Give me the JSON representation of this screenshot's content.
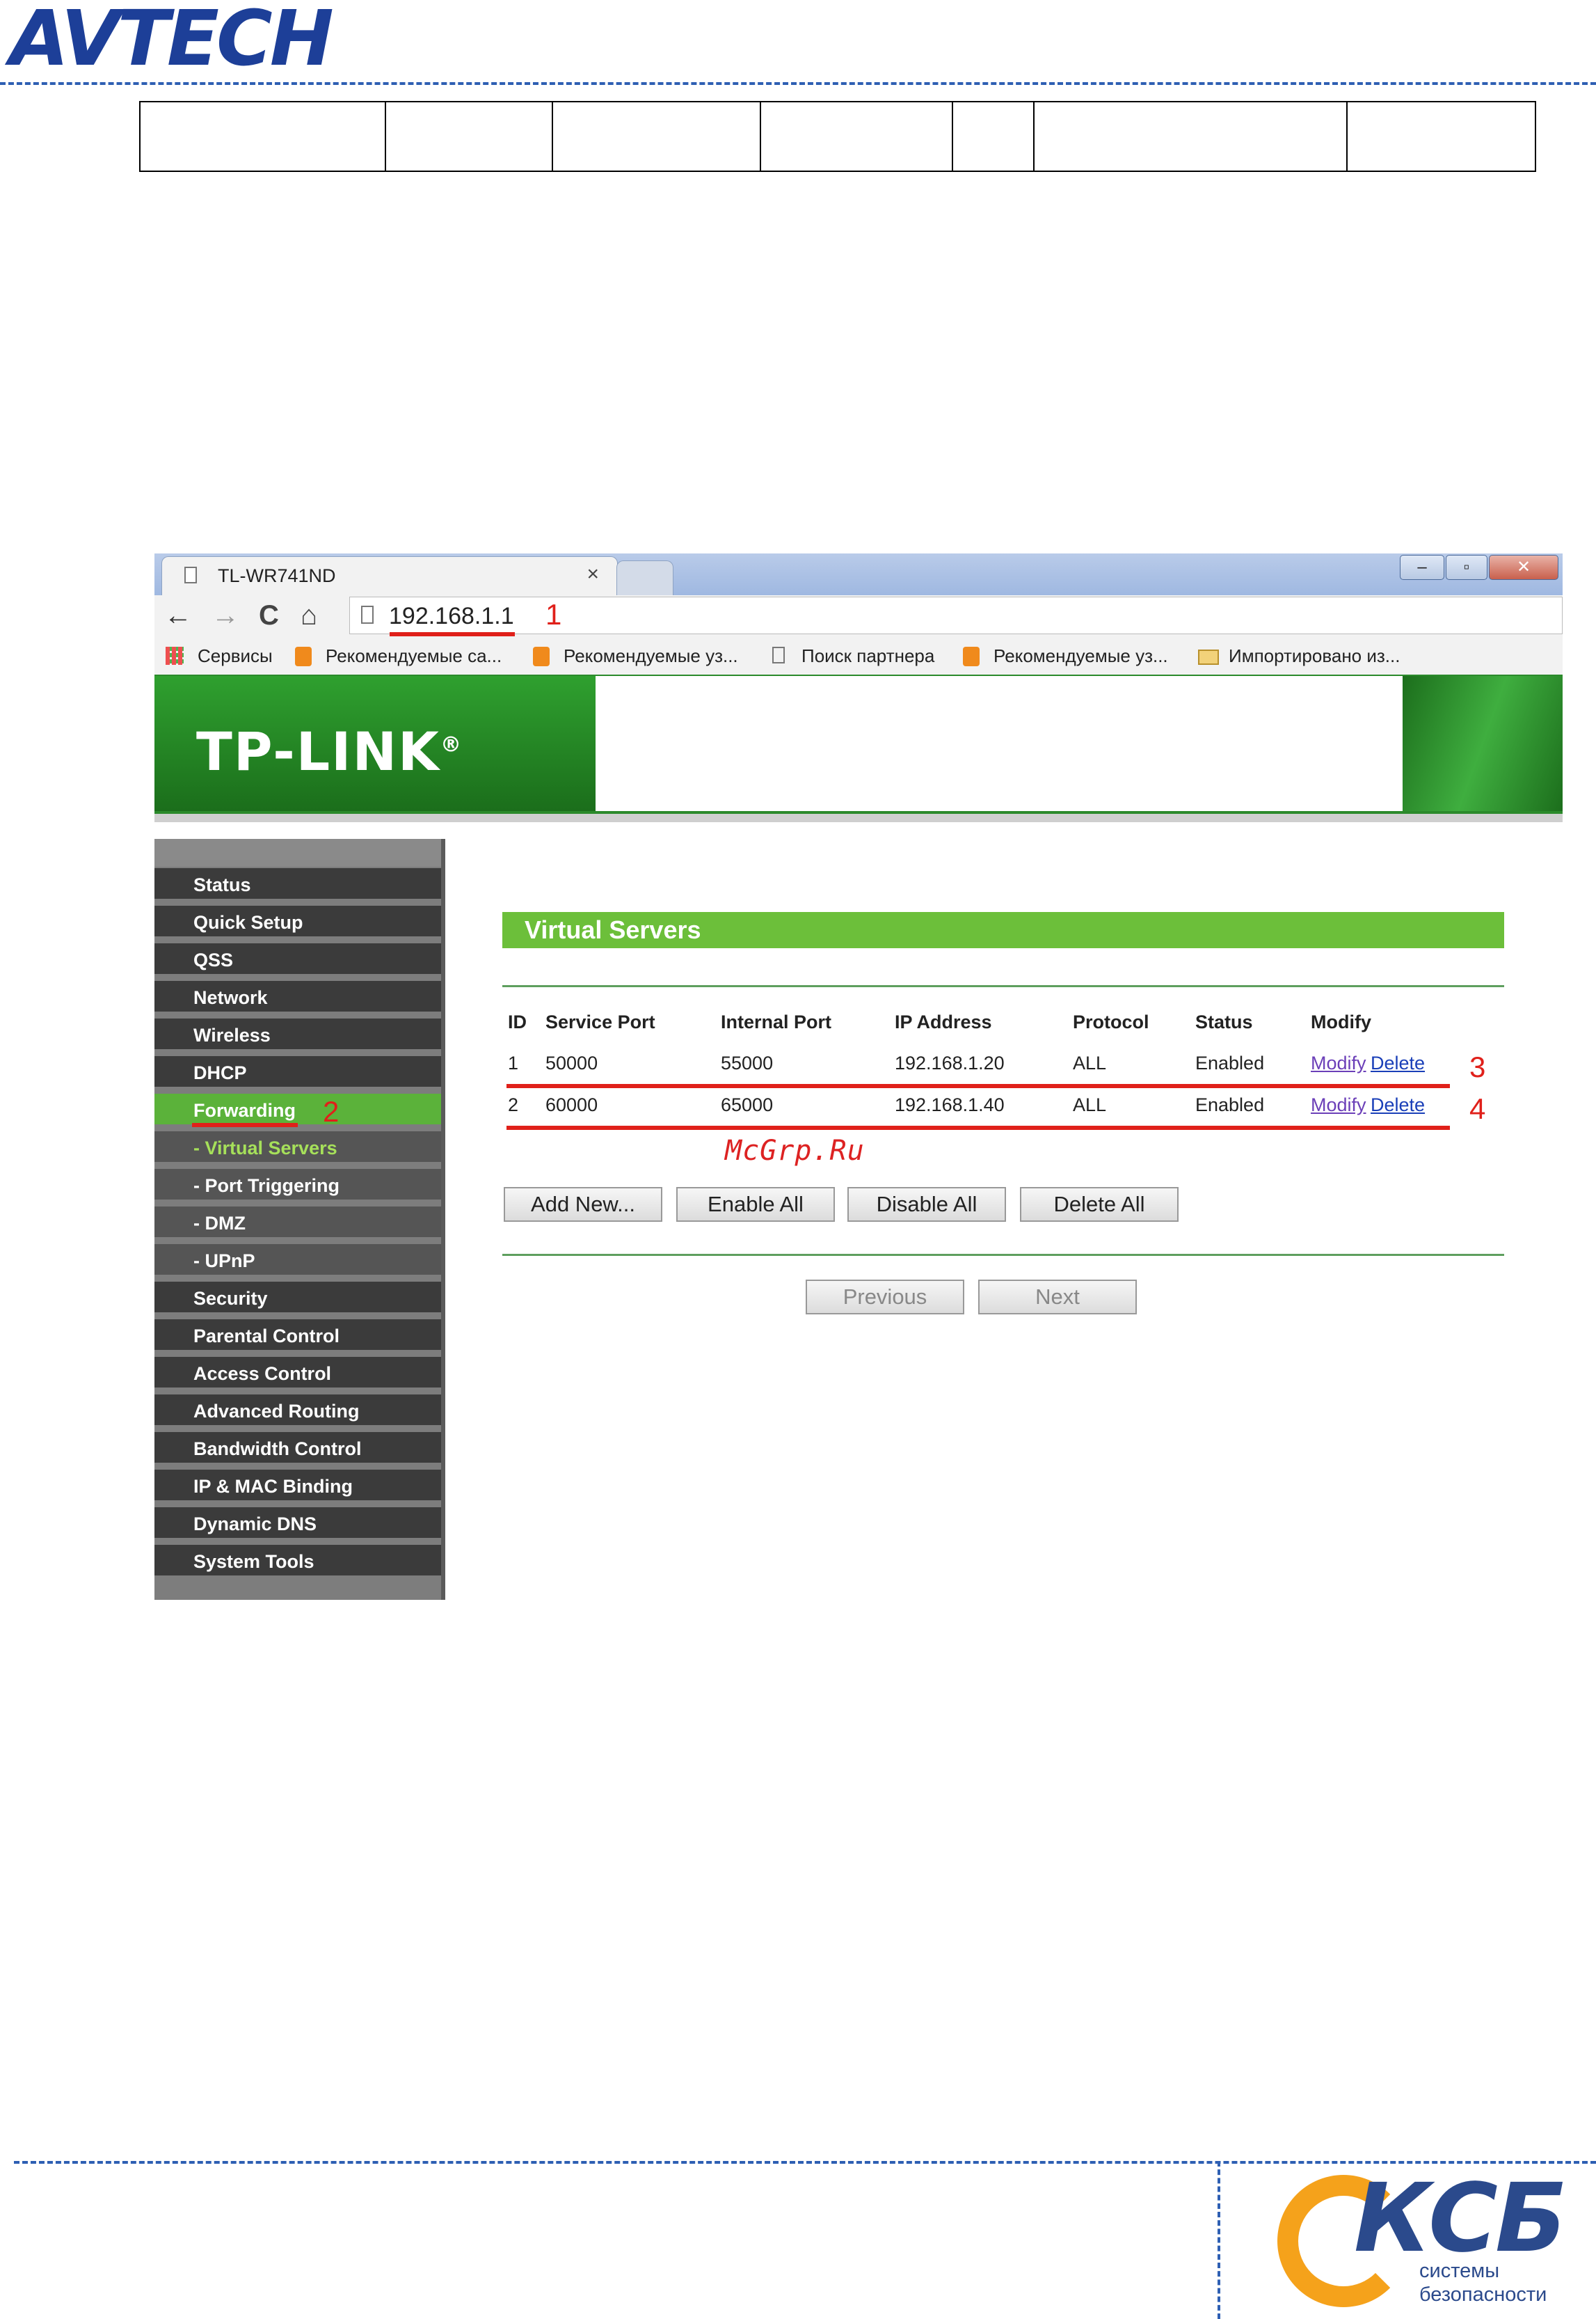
{
  "page": {
    "logo": "AVTECH"
  },
  "browser": {
    "tab_title": "TL-WR741ND",
    "tab_close": "×",
    "address": "192.168.1.1",
    "nav": {
      "back": "←",
      "forward": "→",
      "reload": "C",
      "home": "⌂"
    },
    "window_buttons": [
      "–",
      "▫",
      "✕"
    ],
    "bookmarks": [
      "Сервисы",
      "Рекомендуемые са...",
      "Рекомендуемые уз...",
      "Поиск партнера",
      "Рекомендуемые уз...",
      "Импортировано из..."
    ]
  },
  "router": {
    "brand": "TP-LINK",
    "brand_mark": "®",
    "menu": [
      {
        "label": "Status"
      },
      {
        "label": "Quick Setup"
      },
      {
        "label": "QSS"
      },
      {
        "label": "Network"
      },
      {
        "label": "Wireless"
      },
      {
        "label": "DHCP"
      },
      {
        "label": "Forwarding"
      },
      {
        "label": "- Virtual Servers"
      },
      {
        "label": "- Port Triggering"
      },
      {
        "label": "- DMZ"
      },
      {
        "label": "- UPnP"
      },
      {
        "label": "Security"
      },
      {
        "label": "Parental Control"
      },
      {
        "label": "Access Control"
      },
      {
        "label": "Advanced Routing"
      },
      {
        "label": "Bandwidth Control"
      },
      {
        "label": "IP & MAC Binding"
      },
      {
        "label": "Dynamic DNS"
      },
      {
        "label": "System Tools"
      }
    ],
    "section_title": "Virtual Servers",
    "table": {
      "headers": [
        "ID",
        "Service Port",
        "Internal Port",
        "IP Address",
        "Protocol",
        "Status",
        "Modify"
      ],
      "rows": [
        {
          "id": "1",
          "service_port": "50000",
          "internal_port": "55000",
          "ip": "192.168.1.20",
          "protocol": "ALL",
          "status": "Enabled",
          "modify": "Modify",
          "delete": "Delete"
        },
        {
          "id": "2",
          "service_port": "60000",
          "internal_port": "65000",
          "ip": "192.168.1.40",
          "protocol": "ALL",
          "status": "Enabled",
          "modify": "Modify",
          "delete": "Delete"
        }
      ]
    },
    "buttons": {
      "add_new": "Add New...",
      "enable_all": "Enable All",
      "disable_all": "Disable All",
      "delete_all": "Delete All",
      "previous": "Previous",
      "next": "Next"
    }
  },
  "annotations": {
    "n1": "1",
    "n2": "2",
    "n3": "3",
    "n4": "4",
    "watermark": "McGrp.Ru"
  },
  "footer": {
    "brand": "КСБ",
    "line1": "системы",
    "line2": "безопасности"
  },
  "colors": {
    "tplink_green": "#6cbf3a",
    "menu_dark": "#3b3b3b",
    "annotation_red": "#e0201a",
    "avtech_blue": "#1d3f98",
    "ksb_orange": "#f5a21b"
  }
}
